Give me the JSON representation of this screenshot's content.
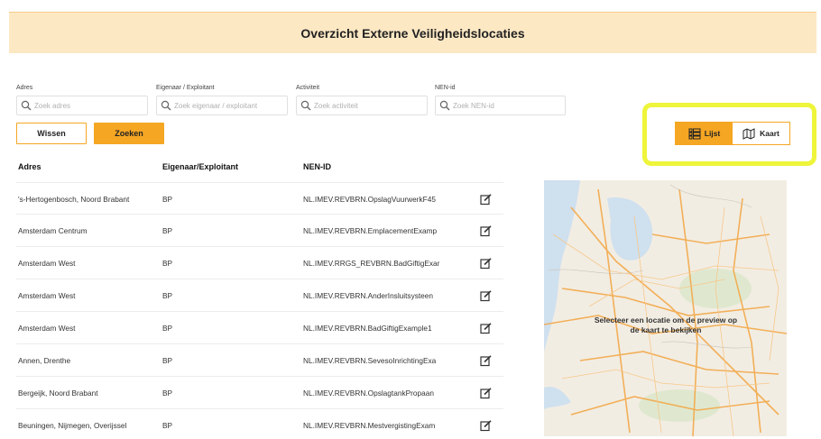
{
  "header": {
    "title": "Overzicht Externe Veiligheidslocaties"
  },
  "filters": [
    {
      "label": "Adres",
      "placeholder": "Zoek adres"
    },
    {
      "label": "Eigenaar / Exploitant",
      "placeholder": "Zoek eigenaar / exploitant"
    },
    {
      "label": "Activiteit",
      "placeholder": "Zoek activiteit"
    },
    {
      "label": "NEN-id",
      "placeholder": "Zoek NEN-id"
    }
  ],
  "buttons": {
    "clear": "Wissen",
    "search": "Zoeken"
  },
  "view_toggle": {
    "list": "Lijst",
    "map": "Kaart",
    "active": "Lijst"
  },
  "table": {
    "headers": [
      "Adres",
      "Eigenaar/Exploitant",
      "NEN-ID"
    ],
    "rows": [
      {
        "adres": "'s-Hertogenbosch, Noord Brabant",
        "eigenaar": "BP",
        "nen": "NL.IMEV.REVBRN.OpslagVuurwerkF45"
      },
      {
        "adres": "Amsterdam Centrum",
        "eigenaar": "BP",
        "nen": "NL.IMEV.REVBRN.EmplacementExamp"
      },
      {
        "adres": "Amsterdam West",
        "eigenaar": "BP",
        "nen": "NL.IMEV.RRGS_REVBRN.BadGiftigExar"
      },
      {
        "adres": "Amsterdam West",
        "eigenaar": "BP",
        "nen": "NL.IMEV.REVBRN.AnderInsluitsysteen"
      },
      {
        "adres": "Amsterdam West",
        "eigenaar": "BP",
        "nen": "NL.IMEV.REVBRN.BadGiftigExample1"
      },
      {
        "adres": "Annen, Drenthe",
        "eigenaar": "BP",
        "nen": "NL.IMEV.REVBRN.SevesoInrichtingExa"
      },
      {
        "adres": "Bergeijk, Noord Brabant",
        "eigenaar": "BP",
        "nen": "NL.IMEV.REVBRN.OpslagtankPropaan"
      },
      {
        "adres": "Beuningen, Nijmegen, Overijssel",
        "eigenaar": "BP",
        "nen": "NL.IMEV.REVBRN.MestvergistingExam"
      }
    ]
  },
  "map_preview": {
    "message": "Selecteer een locatie om de preview op de kaart te bekijken"
  },
  "colors": {
    "accent": "#f5a623",
    "banner": "#fde8c4",
    "highlight": "#eef53a"
  },
  "icons": {
    "search": "search-icon",
    "edit": "edit-icon",
    "list": "list-icon",
    "map": "map-icon"
  }
}
